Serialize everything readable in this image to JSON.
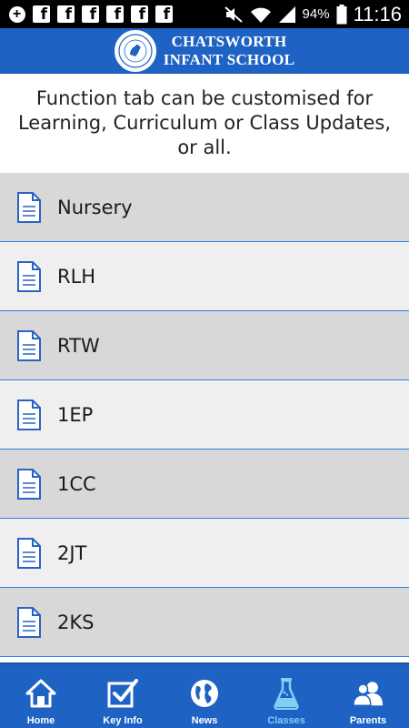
{
  "status_bar": {
    "battery_percent": "94%",
    "time": "11:16"
  },
  "header": {
    "school_name_line1": "CHATSWORTH",
    "school_name_line2": "INFANT SCHOOL"
  },
  "intro": {
    "text": "Function tab can be customised for Learning, Curriculum or Class Updates, or all."
  },
  "list": {
    "items": [
      {
        "label": "Nursery"
      },
      {
        "label": "RLH"
      },
      {
        "label": "RTW"
      },
      {
        "label": "1EP"
      },
      {
        "label": "1CC"
      },
      {
        "label": "2JT"
      },
      {
        "label": "2KS"
      }
    ]
  },
  "tabs": [
    {
      "label": "Home",
      "icon": "home-icon",
      "active": false
    },
    {
      "label": "Key Info",
      "icon": "checkbox-icon",
      "active": false
    },
    {
      "label": "News",
      "icon": "globe-icon",
      "active": false
    },
    {
      "label": "Classes",
      "icon": "flask-icon",
      "active": true
    },
    {
      "label": "Parents",
      "icon": "people-icon",
      "active": false
    }
  ],
  "colors": {
    "header_bg": "#1e63c4",
    "active_tab": "#7fd0f5",
    "list_divider": "#2f7fe0"
  }
}
